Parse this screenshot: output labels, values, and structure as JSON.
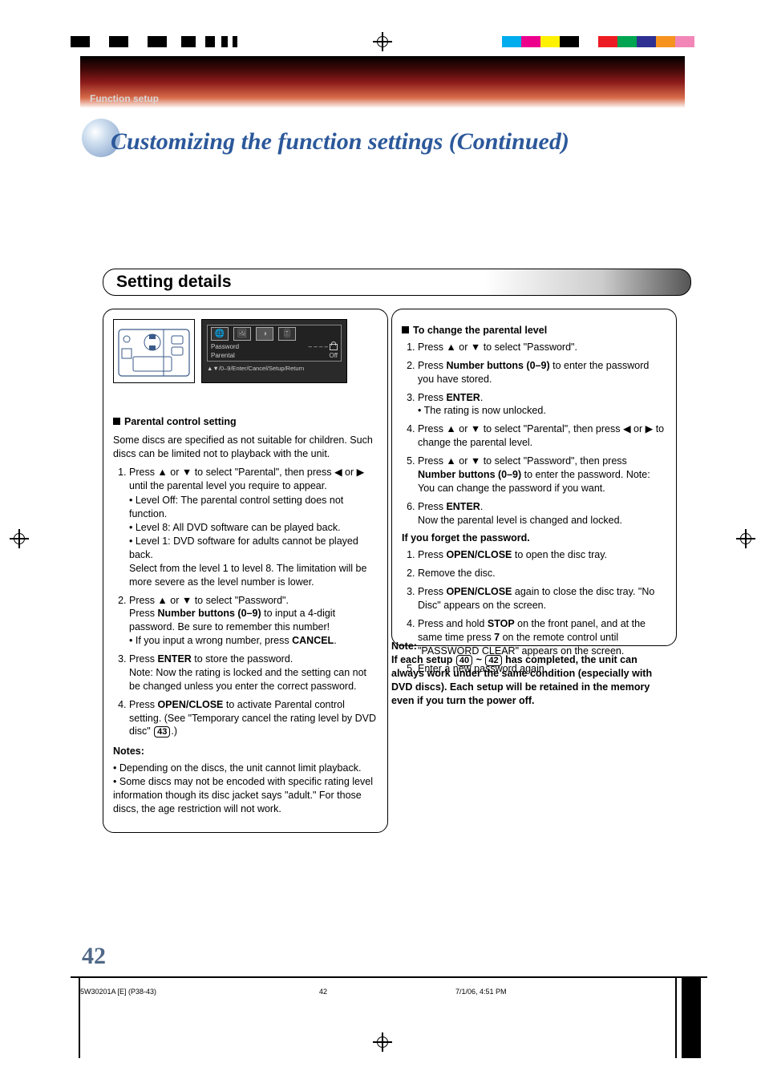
{
  "breadcrumb": "Function setup",
  "title": "Customizing the function settings (Continued)",
  "section_header": "Setting details",
  "osd": {
    "label_password": "Password",
    "value_password": "– – – –",
    "label_parental": "Parental",
    "value_parental": "Off",
    "hint": "▲▼/0–9/Enter/Cancel/Setup/Return"
  },
  "left": {
    "h_parental": "Parental control setting",
    "intro": "Some discs are specified as not suitable for children. Such discs can be limited not to playback with the unit.",
    "step1_a": "Press ▲ or ▼ to select \"Parental\", then press ◀ or ▶ until the parental level you require to appear.",
    "step1_b_level_off": "Level Off: The parental control setting does not function.",
    "step1_b_level_8": "Level 8:  All DVD software can be played back.",
    "step1_b_level_1": "Level 1:  DVD software for adults cannot be played back.",
    "step1_c": "Select from the level 1 to level 8. The limitation will be more severe as the level number is lower.",
    "step2_a": "Press ▲ or ▼ to select \"Password\".",
    "step2_b_pre": "Press ",
    "step2_b_strong": "Number buttons (0–9)",
    "step2_b_post": " to input a 4-digit password. Be sure to remember this number!",
    "step2_c_pre": "• If you input a wrong number, press ",
    "step2_c_strong": "CANCEL",
    "step2_c_post": ".",
    "step3_a_pre": "Press ",
    "step3_a_strong": "ENTER",
    "step3_a_post": " to store the password.",
    "step3_b": "Note: Now the rating is locked and the setting can not be changed unless you enter the correct password.",
    "step4_a_pre": "Press ",
    "step4_a_strong": "OPEN/CLOSE",
    "step4_a_post": " to activate Parental control setting. (See \"Temporary cancel the rating level by DVD disc\" ",
    "step4_ref": "43",
    "step4_end": ".)",
    "notes_h": "Notes:",
    "notes_1": "Depending on the discs, the unit cannot limit playback.",
    "notes_2": "Some discs may not be encoded with specific rating level information though its disc jacket says \"adult.\" For those discs, the age restriction will not work."
  },
  "right": {
    "h_change": "To change the parental level",
    "s1": "Press ▲ or ▼ to select \"Password\".",
    "s2_pre": "Press ",
    "s2_strong": "Number buttons (0–9)",
    "s2_post": " to enter the password you have stored.",
    "s3_pre": "Press ",
    "s3_strong": "ENTER",
    "s3_post": ".",
    "s3_note": "• The rating is now unlocked.",
    "s4": "Press ▲ or ▼ to select \"Parental\", then press ◀ or ▶ to change the parental level.",
    "s5_pre": "Press ▲ or ▼ to select \"Password\", then press ",
    "s5_strong": "Number buttons (0–9)",
    "s5_post": " to enter the password. Note: You can change the password if you want.",
    "s6_pre": "Press ",
    "s6_strong": "ENTER",
    "s6_post": ".",
    "s6_note": "Now the parental level is changed and locked.",
    "forget_h": "If you forget the password.",
    "f1_pre": "Press ",
    "f1_strong": "OPEN/CLOSE",
    "f1_post": " to open the disc tray.",
    "f2": "Remove the disc.",
    "f3_pre": "Press ",
    "f3_strong": "OPEN/CLOSE",
    "f3_post": " again to close the disc tray. \"No Disc\" appears on the screen.",
    "f4_pre": "Press and hold ",
    "f4_strong1": "STOP",
    "f4_mid": " on the front panel, and at the same time press ",
    "f4_strong2": "7",
    "f4_post": " on the remote control until \"PASSWORD CLEAR\" appears on the screen.",
    "f5": "Enter a new password again."
  },
  "outer_note": {
    "label": "Note:",
    "pre": "If each setup ",
    "ref1": "40",
    "tilde": " ~ ",
    "ref2": "42",
    "post": " has completed, the unit can always work under the same condition (especially with DVD discs). Each setup will be retained in the memory even if you turn the power off."
  },
  "page_number": "42",
  "footer": {
    "left": "5W30201A [E] (P38-43)",
    "center": "42",
    "right": "7/1/06, 4:51 PM"
  }
}
